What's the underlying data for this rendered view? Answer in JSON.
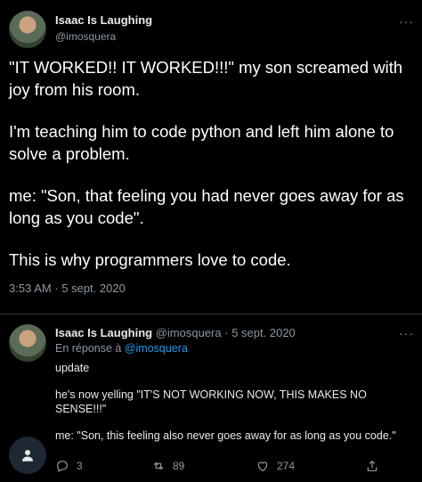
{
  "main_tweet": {
    "author_name": "Isaac Is Laughing",
    "handle": "@imosquera",
    "more": "···",
    "paragraphs": [
      "\"IT WORKED!! IT WORKED!!!\" my son screamed with joy from his room.",
      "I'm teaching him to code python and left him alone to solve a problem.",
      "me: \"Son, that feeling you had never goes away for as long as you code\".",
      "This is why programmers love to code."
    ],
    "timestamp": "3:53 AM · 5 sept. 2020"
  },
  "reply": {
    "author_name": "Isaac Is Laughing",
    "handle": "@imosquera",
    "separator": "·",
    "date": "5 sept. 2020",
    "more": "···",
    "replying_prefix": "En réponse à",
    "replying_to": "@imosquera",
    "paragraphs": [
      "update",
      "he's now yelling \"IT'S NOT WORKING NOW, THIS MAKES NO SENSE!!!\"",
      "me: \"Son, this feeling also never goes away for as long as you code.\""
    ],
    "actions": {
      "replies": "3",
      "retweets": "89",
      "likes": "274"
    }
  },
  "icons": [
    "avatar",
    "more-icon",
    "reply-icon",
    "retweet-icon",
    "like-icon",
    "share-icon",
    "person-icon"
  ],
  "colors": {
    "background": "#000000",
    "text": "#e7e9ea",
    "muted": "#8b98a5",
    "link": "#1d9bf0",
    "divider": "#2f3336"
  }
}
